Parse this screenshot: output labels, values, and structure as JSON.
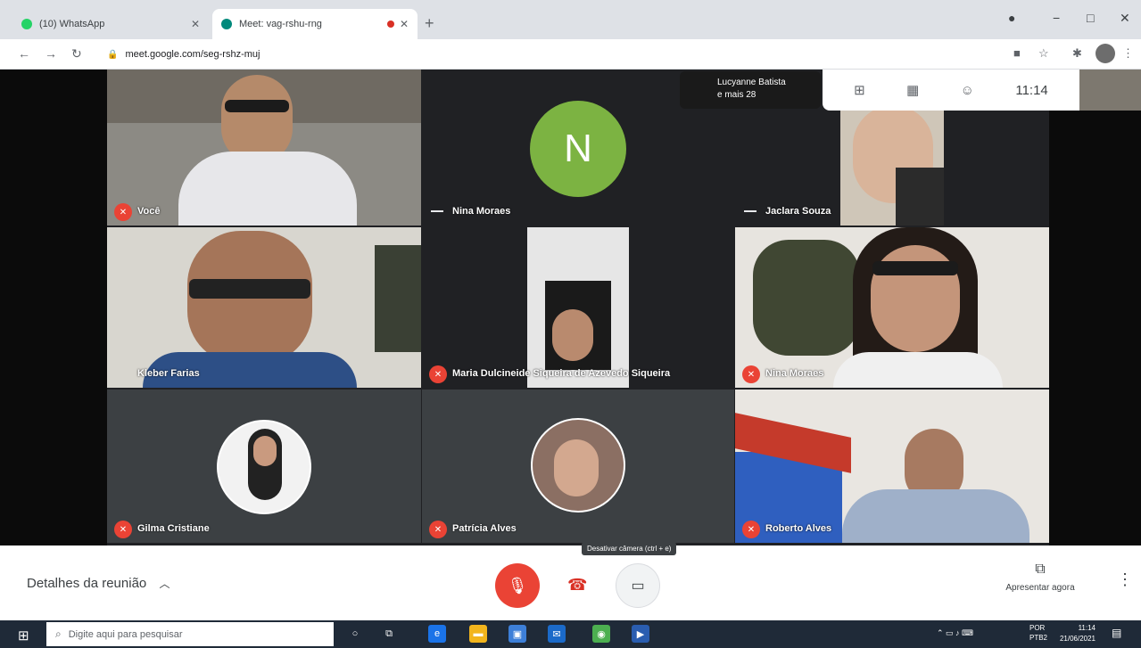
{
  "browser": {
    "tabs": [
      {
        "title": "(10) WhatsApp",
        "favicon_color": "#25d366"
      },
      {
        "title": "Meet: vag-rshu-rng",
        "favicon_color": "#00897b"
      }
    ],
    "new_tab_label": "+",
    "url": "meet.google.com/seg-rshz-muj",
    "window_controls": {
      "minimize": "−",
      "restore": "□",
      "close": "✕"
    }
  },
  "meeting": {
    "pinned_chip": {
      "line1": "Lucyanne Batista",
      "line2": "e mais 28"
    },
    "overlay": {
      "time": "11:14"
    },
    "tiles": [
      {
        "name": "Você",
        "muted": true
      },
      {
        "name": "Nina Moraes",
        "muted": false,
        "initial": "N",
        "avatar_color": "#7cb342"
      },
      {
        "name": "Jaclara Souza",
        "muted": false
      },
      {
        "name": "Kleber Farias",
        "muted": false
      },
      {
        "name": "Maria Dulcineide Siqueira de Azevedo Siqueira",
        "muted": true
      },
      {
        "name": "Nina Moraes",
        "muted": true
      },
      {
        "name": "Gilma Cristiane",
        "muted": true
      },
      {
        "name": "Patrícia Alves",
        "muted": true
      },
      {
        "name": "Roberto Alves",
        "muted": true
      }
    ]
  },
  "controls": {
    "details_label": "Detalhes da reunião",
    "tooltip": "Desativar câmera (ctrl + e)",
    "present_label": "Apresentar agora"
  },
  "taskbar": {
    "search_placeholder": "Digite aqui para pesquisar",
    "tray_language": "POR",
    "tray_layout": "PTB2",
    "clock_time": "11:14",
    "clock_date": "21/06/2021"
  }
}
